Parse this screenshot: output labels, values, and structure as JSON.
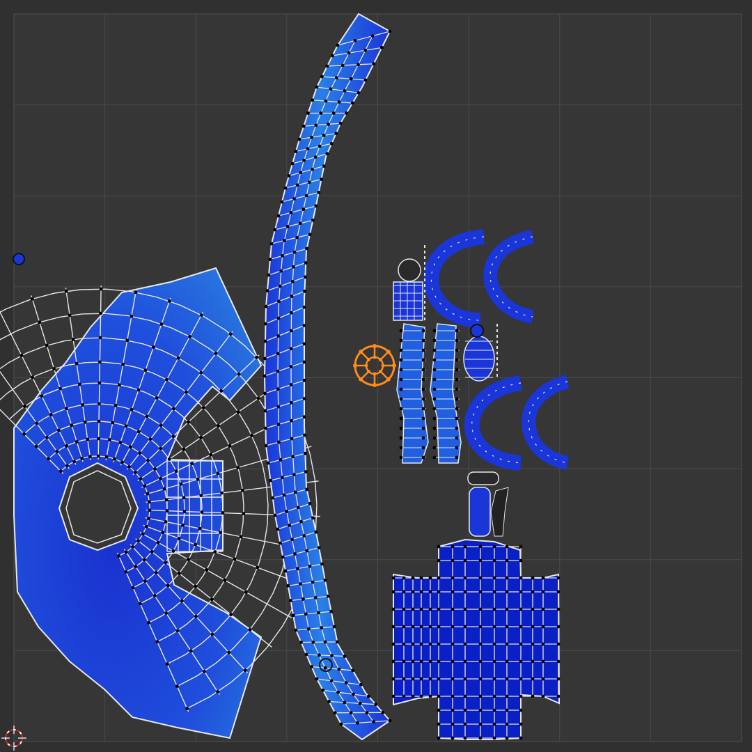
{
  "view": {
    "type": "uv-editor-viewport",
    "background_color": "#303030",
    "uv_area_color": "#3a3a3a",
    "grid_line_color": "#4a4a4a",
    "grid_subdivisions": 8
  },
  "colors": {
    "island_fill": "#1a35d8",
    "island_fill_light": "#2f8fe6",
    "edge": "#e8e8e8",
    "vertex": "#000000",
    "selected": "#ff8c1a",
    "cursor": "#e02020"
  },
  "islands": [
    {
      "name": "curved-fan-panel",
      "selected": false
    },
    {
      "name": "long-curved-strip",
      "selected": false
    },
    {
      "name": "cross-shaped-panel",
      "selected": false
    },
    {
      "name": "small-c-arcs-group",
      "selected": false
    },
    {
      "name": "small-strips-group",
      "selected": false
    },
    {
      "name": "wheel-island",
      "selected": true
    }
  ],
  "icons": [
    "2d-cursor-icon"
  ]
}
